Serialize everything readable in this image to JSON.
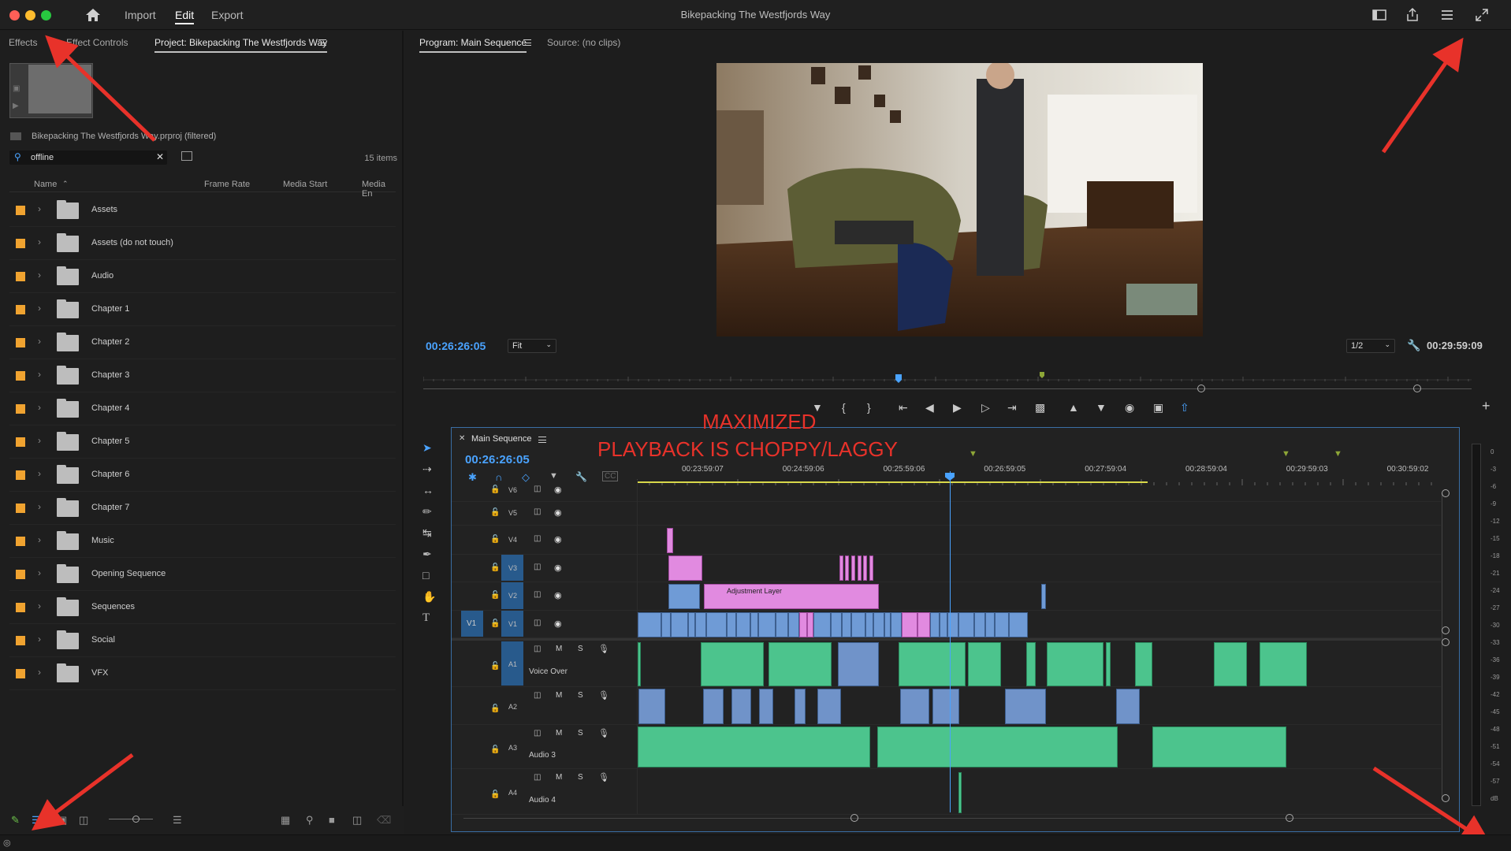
{
  "window": {
    "title": "Bikepacking The Westfjords Way",
    "nav": [
      "Import",
      "Edit",
      "Export"
    ],
    "active_nav": "Edit"
  },
  "left_panel": {
    "tabs": [
      "Effects",
      "Effect Controls",
      "Project: Bikepacking The Westfjords Way"
    ],
    "active_tab": "Project: Bikepacking The Westfjords Way",
    "project_path": "Bikepacking The Westfjords Way.prproj (filtered)",
    "search_value": "offline",
    "item_count": "15 items",
    "columns": [
      "Name",
      "Frame Rate",
      "Media Start",
      "Media En"
    ],
    "bins": [
      "Assets",
      "Assets (do not touch)",
      "Audio",
      "Chapter 1",
      "Chapter 2",
      "Chapter 3",
      "Chapter 4",
      "Chapter 5",
      "Chapter 6",
      "Chapter 7",
      "Music",
      "Opening Sequence",
      "Sequences",
      "Social",
      "VFX"
    ],
    "bin_color": "#f0a330"
  },
  "program_monitor": {
    "tabs": [
      "Program: Main Sequence",
      "Source: (no clips)"
    ],
    "active_tab": "Program: Main Sequence",
    "timecode": "00:26:26:05",
    "zoom": "Fit",
    "resolution": "1/2",
    "duration": "00:29:59:09"
  },
  "timeline": {
    "sequence_name": "Main Sequence",
    "timecode": "00:26:26:05",
    "ruler_labels": [
      "00:23:59:07",
      "00:24:59:06",
      "00:25:59:06",
      "00:26:59:05",
      "00:27:59:04",
      "00:28:59:04",
      "00:29:59:03",
      "00:30:59:02"
    ],
    "video_tracks": [
      "V6",
      "V5",
      "V4",
      "V3",
      "V2",
      "V1"
    ],
    "audio_tracks": [
      {
        "id": "A1",
        "name": "Voice Over"
      },
      {
        "id": "A2",
        "name": ""
      },
      {
        "id": "A3",
        "name": "Audio 3"
      },
      {
        "id": "A4",
        "name": "Audio 4"
      }
    ],
    "adjustment_layer_label": "Adjustment Layer",
    "track_buttons": {
      "mute": "M",
      "solo": "S"
    }
  },
  "meter": {
    "labels": [
      "0",
      "-3",
      "-6",
      "-9",
      "-12",
      "-15",
      "-18",
      "-21",
      "-24",
      "-27",
      "-30",
      "-33",
      "-36",
      "-39",
      "-42",
      "-45",
      "-48",
      "-51",
      "-54",
      "-57",
      "dB"
    ]
  },
  "annotations": {
    "line1": "MAXIMIZED",
    "line2": "PLAYBACK IS CHOPPY/LAGGY",
    "color": "#e8322a"
  },
  "colors": {
    "accent_blue": "#4aa3ff",
    "video_clip": "#6f9bd6",
    "pink_clip": "#e18ae0",
    "audio_clip": "#4cc48d"
  }
}
